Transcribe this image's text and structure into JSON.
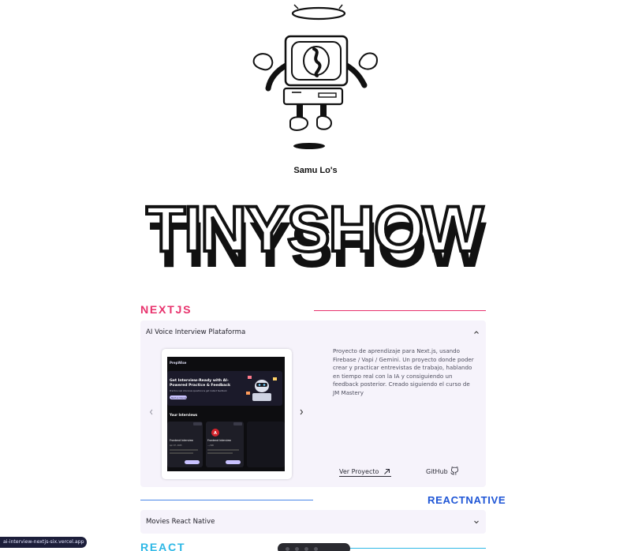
{
  "hero": {
    "byline": "Samu Lo's",
    "logo": "TINYSHOW",
    "mascot_icon": "tv-robot-mascot-icon"
  },
  "sections": [
    {
      "title": "NEXTJS",
      "color": "#e8336d",
      "project": {
        "title": "AI Voice Interview Plataforma",
        "expanded": true,
        "description": "Proyecto de aprendizaje para Next.js, usando Firebase / Vapi / Gemini. Un proyecto donde poder crear y practicar entrevistas de trabajo, hablando en tiempo real con la IA y consiguiendo un feedback posterior. Creado siguiendo el curso de JM Mastery",
        "project_link": "Ver Proyecto",
        "github_link": "GitHub",
        "screenshot": {
          "app_name": "PrepWise",
          "hero_line1": "Get Interview-Ready with AI-",
          "hero_line2": "Powered Practice & Feedback",
          "hero_sub": "Practice real interview questions & get instant feedback",
          "cta": "Start an Interview",
          "section_label": "Your Interviews",
          "card1_role": "Frontend Interview",
          "card2_role": "Frontend Interview",
          "card_date": "Apr 07, 2025",
          "card_score": "---/100",
          "card_badge": "Technical",
          "card_button": "View Interview"
        }
      }
    },
    {
      "title": "REACTNATIVE",
      "color": "#1f56d6",
      "project": {
        "title": "Movies React Native",
        "expanded": false
      }
    },
    {
      "title": "REACT",
      "color": "#2fb8e6"
    }
  ],
  "status": {
    "url": "ai-interview-nextjs-six.vercel.app"
  },
  "colors": {
    "panel_bg": "#f6f3fb",
    "ink": "#111111"
  }
}
